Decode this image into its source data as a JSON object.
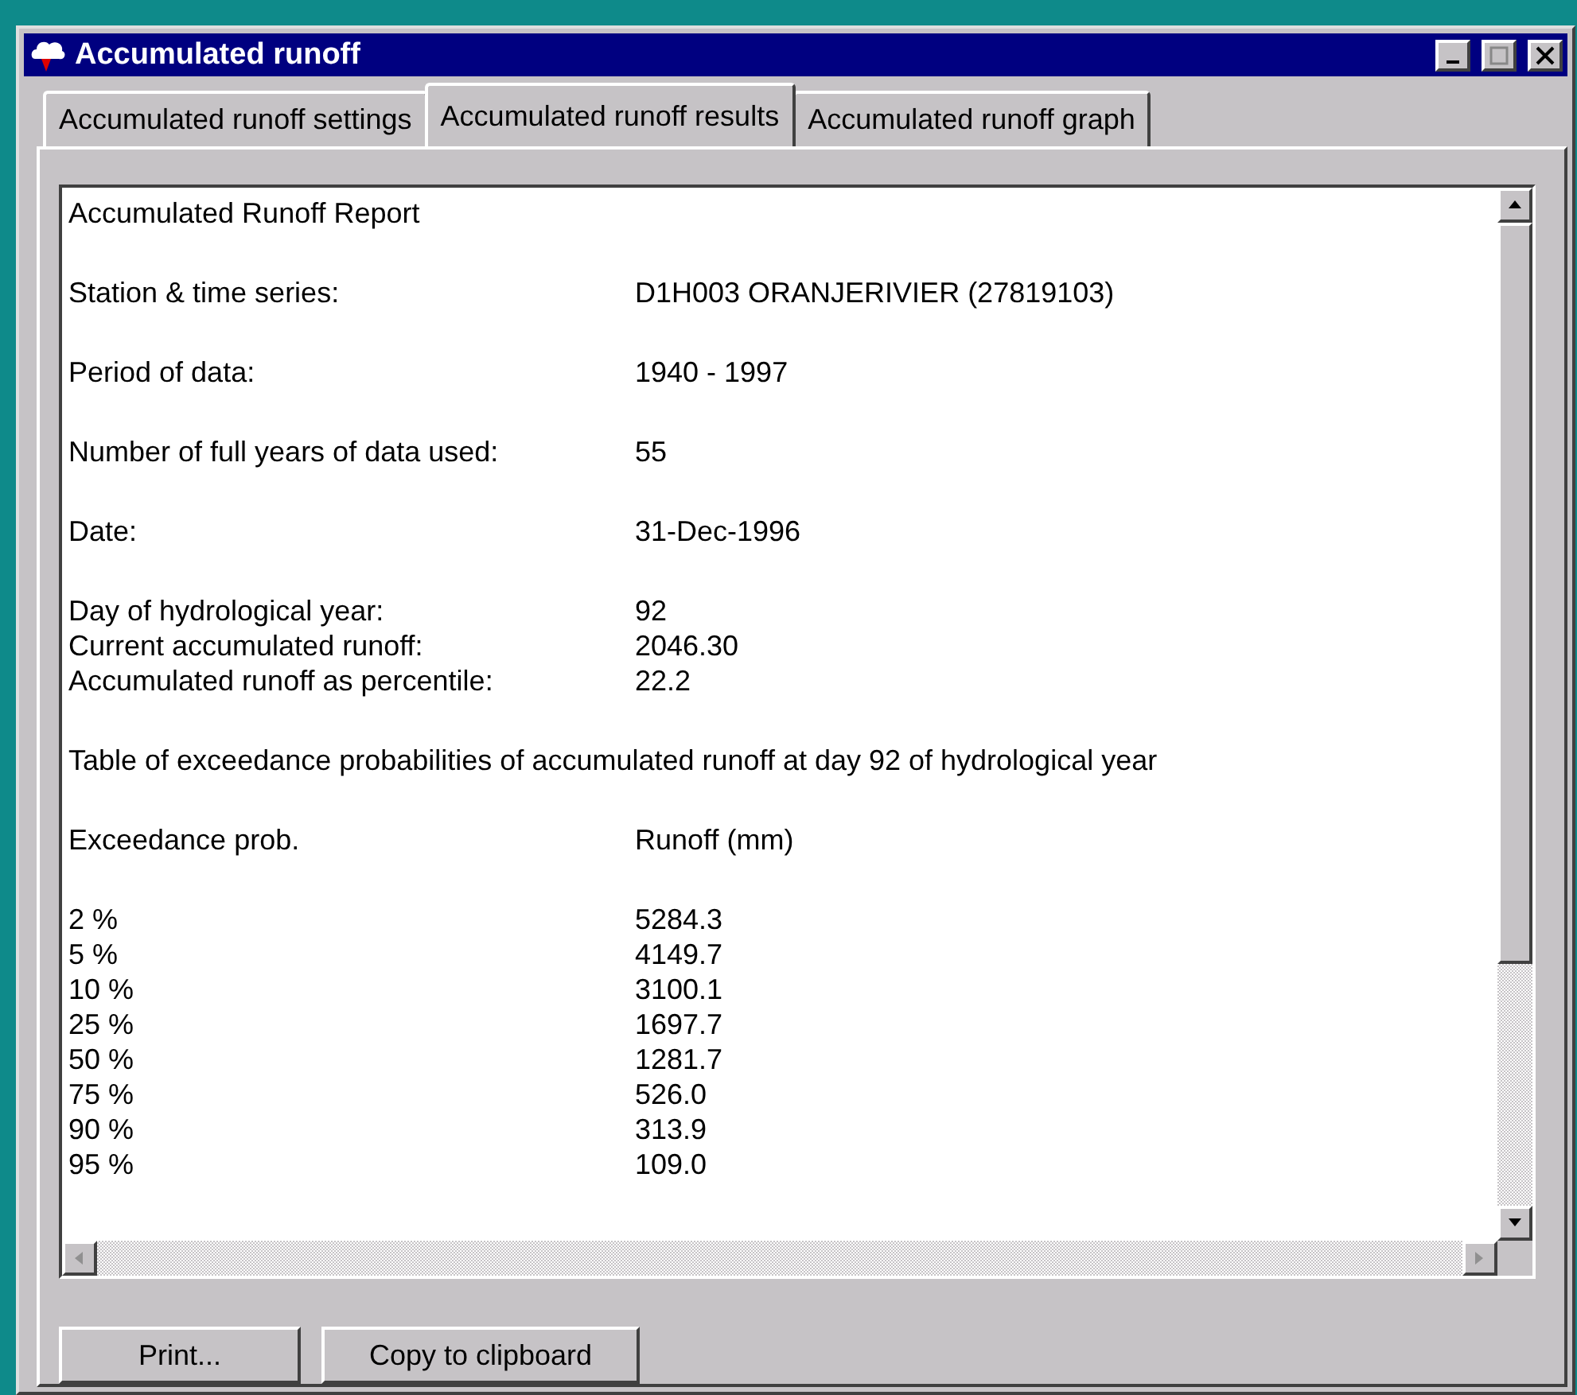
{
  "window": {
    "title": "Accumulated runoff"
  },
  "tabs": [
    {
      "label": "Accumulated runoff settings",
      "selected": false
    },
    {
      "label": "Accumulated runoff results",
      "selected": true
    },
    {
      "label": "Accumulated runoff graph",
      "selected": false
    }
  ],
  "report": {
    "groups": [
      [
        {
          "label": "Accumulated Runoff Report"
        }
      ],
      [
        {
          "label": "Station & time series:",
          "value": "D1H003 ORANJERIVIER (27819103)"
        }
      ],
      [
        {
          "label": "Period of data:",
          "value": "1940 - 1997"
        }
      ],
      [
        {
          "label": "Number of full years of data used:",
          "value": "55"
        }
      ],
      [
        {
          "label": "Date:",
          "value": "31-Dec-1996"
        }
      ],
      [
        {
          "label": "Day of hydrological year:",
          "value": "92"
        },
        {
          "label": "Current accumulated runoff:",
          "value": "2046.30"
        },
        {
          "label": "Accumulated runoff as percentile:",
          "value": "22.2"
        }
      ],
      [
        {
          "label": "Table of exceedance probabilities of accumulated runoff at day 92 of hydrological year"
        }
      ],
      [
        {
          "label": "Exceedance prob.",
          "value": "Runoff (mm)"
        }
      ],
      [
        {
          "label": "2 %",
          "value": "5284.3"
        },
        {
          "label": "5 %",
          "value": "4149.7"
        },
        {
          "label": "10 %",
          "value": "3100.1"
        },
        {
          "label": "25 %",
          "value": "1697.7"
        },
        {
          "label": "50 %",
          "value": "1281.7"
        },
        {
          "label": "75 %",
          "value": "526.0"
        },
        {
          "label": "90 %",
          "value": "313.9"
        },
        {
          "label": "95 %",
          "value": "109.0"
        }
      ]
    ]
  },
  "buttons": [
    "Print...",
    "Copy to clipboard"
  ]
}
